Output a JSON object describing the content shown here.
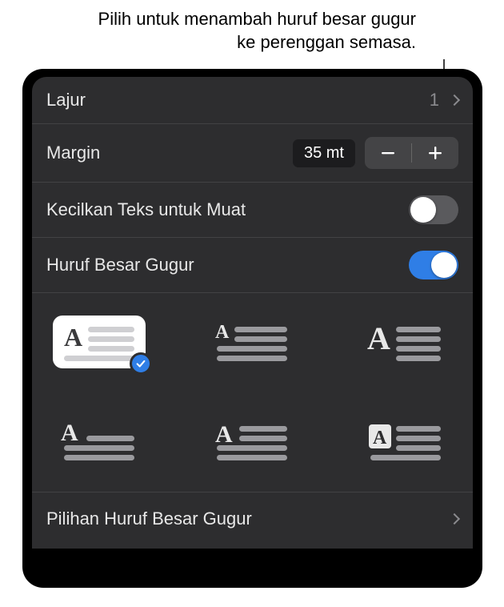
{
  "callout": "Pilih untuk menambah huruf besar gugur ke perenggan semasa.",
  "rows": {
    "lajur": {
      "label": "Lajur",
      "value": "1"
    },
    "margin": {
      "label": "Margin",
      "value": "35 mt"
    },
    "shrink": {
      "label": "Kecilkan Teks untuk Muat",
      "state": "off"
    },
    "dropcap": {
      "label": "Huruf Besar Gugur",
      "state": "on"
    }
  },
  "dropcap_styles": {
    "selected_index": 0,
    "options": [
      {
        "name": "dropcap-style-1"
      },
      {
        "name": "dropcap-style-2"
      },
      {
        "name": "dropcap-style-3"
      },
      {
        "name": "dropcap-style-4"
      },
      {
        "name": "dropcap-style-5"
      },
      {
        "name": "dropcap-style-6"
      }
    ]
  },
  "options_row": {
    "label": "Pilihan Huruf Besar Gugur"
  },
  "colors": {
    "accent": "#2f7ee6",
    "panel_bg": "#2d2d2f",
    "line_color": "#9a9a9e"
  }
}
